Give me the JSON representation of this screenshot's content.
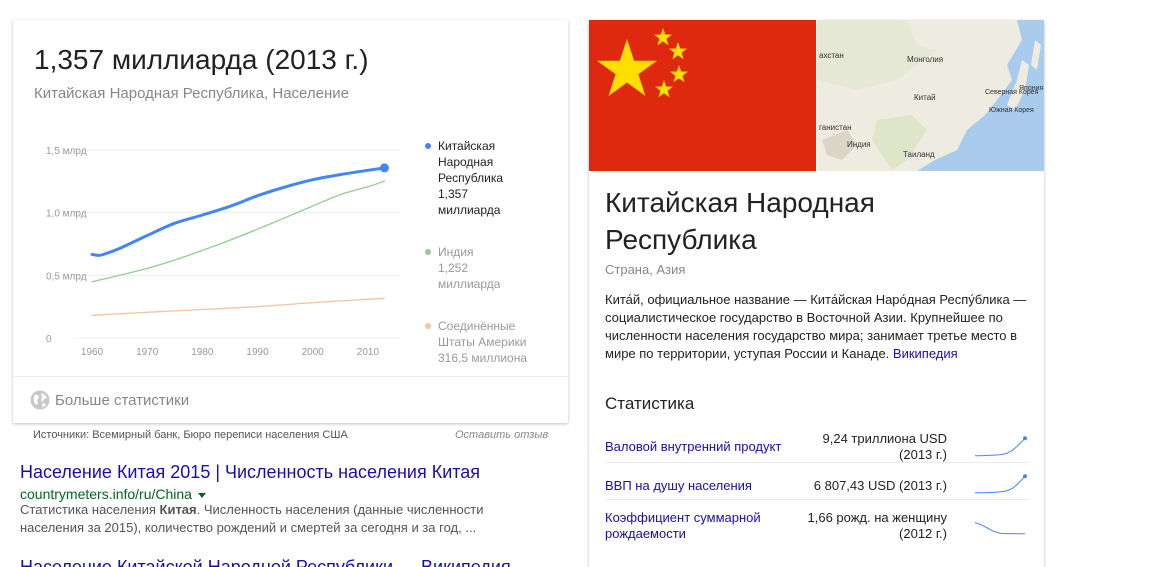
{
  "population_card": {
    "value": "1,357 миллиарда (2013 г.)",
    "subtitle": "Китайская Народная Республика, Население",
    "more_stats": "Больше статистики",
    "sources": "Источники: Всемирный банк, Бюро переписи населения США",
    "feedback": "Оставить отзыв"
  },
  "chart_data": {
    "type": "line",
    "x_ticks": [
      "1960",
      "1970",
      "1980",
      "1990",
      "2000",
      "2010"
    ],
    "y_ticks": [
      "0",
      "0,5 млрд",
      "1,0 млрд",
      "1,5 млрд"
    ],
    "ylim": [
      0,
      1.5
    ],
    "xlim": [
      1958,
      2016
    ],
    "grid": true,
    "legend_position": "right",
    "series": [
      {
        "name": "Китайская Народная Республика",
        "legend_value": "1,357 миллиарда",
        "color": "#4285f4",
        "x": [
          1960,
          1961,
          1962,
          1965,
          1970,
          1975,
          1980,
          1985,
          1990,
          1995,
          2000,
          2005,
          2010,
          2013
        ],
        "y": [
          0.667,
          0.66,
          0.666,
          0.715,
          0.818,
          0.916,
          0.981,
          1.051,
          1.135,
          1.205,
          1.263,
          1.304,
          1.338,
          1.357
        ]
      },
      {
        "name": "Индия",
        "legend_value": "1,252 миллиарда",
        "color": "#8fce8f",
        "x": [
          1960,
          1965,
          1970,
          1975,
          1980,
          1985,
          1990,
          1995,
          2000,
          2005,
          2010,
          2013
        ],
        "y": [
          0.449,
          0.5,
          0.555,
          0.622,
          0.699,
          0.781,
          0.868,
          0.96,
          1.053,
          1.144,
          1.206,
          1.252
        ]
      },
      {
        "name": "Соединённые Штаты Америки",
        "legend_value": "316,5 миллиона",
        "color": "#f5c49e",
        "x": [
          1960,
          1970,
          1980,
          1990,
          2000,
          2010,
          2013
        ],
        "y": [
          0.181,
          0.205,
          0.227,
          0.25,
          0.282,
          0.309,
          0.3165
        ]
      }
    ]
  },
  "legend": [
    {
      "lines": [
        "Китайская",
        "Народная",
        "Республика",
        "1,357",
        "миллиарда"
      ],
      "color": "#4285f4"
    },
    {
      "lines": [
        "Индия",
        "1,252",
        "миллиарда"
      ],
      "color": "#8fce8f"
    },
    {
      "lines": [
        "Соединённые",
        "Штаты Америки",
        "316,5 миллиона"
      ],
      "color": "#f5c49e"
    }
  ],
  "results": [
    {
      "title": "Население Китая 2015 | Численность населения Китая",
      "url": "countrymeters.info/ru/China",
      "snippet_before": "Статистика населения ",
      "snippet_bold": "Китая",
      "snippet_after": ". Численность населения (данные численности населения за 2015), количество рождений и смертей за сегодня и за год, ..."
    },
    {
      "title": "Население Китайской Народной Республики — Википедия"
    }
  ],
  "knowledge_panel": {
    "map_labels": [
      "ахстан",
      "Монголия",
      "Китай",
      "Северная Корея",
      "Южная Корея",
      "Япония",
      "ганистан",
      "Индия",
      "Таиланд"
    ],
    "title": "Китайская Народная Республика",
    "subtitle": "Страна, Азия",
    "description": "Кита́й, официальное название — Кита́йская Наро́дная Респу́блика — социалистическое государство в Восточной Азии. Крупнейшее по численности населения государство мира; занимает третье место в мире по территории, уступая России и Канаде.",
    "description_link": "Википедия",
    "stats_heading": "Статистика",
    "stats": [
      {
        "label": "Валовой внутренний продукт",
        "value_line1": "9,24 триллиона USD",
        "value_line2": "(2013 г.)",
        "trend": [
          0.1,
          0.1,
          0.12,
          0.13,
          0.15,
          0.2,
          0.35,
          0.6,
          0.9
        ]
      },
      {
        "label": "ВВП на душу населения",
        "value_line1": "6 807,43 USD (2013 г.)",
        "value_line2": "",
        "trend": [
          0.1,
          0.1,
          0.11,
          0.12,
          0.14,
          0.18,
          0.3,
          0.55,
          0.85
        ]
      },
      {
        "label": "Коэффициент суммарной рождаемости",
        "value_line1": "1,66 рожд. на женщину",
        "value_line2": "(2012 г.)",
        "trend": [
          0.7,
          0.6,
          0.45,
          0.3,
          0.22,
          0.2,
          0.2,
          0.19,
          0.19
        ]
      }
    ]
  }
}
